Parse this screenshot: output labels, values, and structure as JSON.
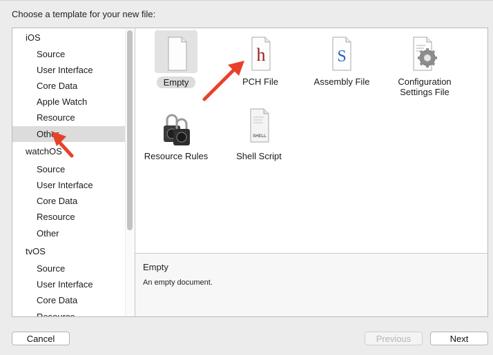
{
  "heading": "Choose a template for your new file:",
  "sidebar": {
    "items": [
      {
        "label": "iOS",
        "kind": "group"
      },
      {
        "label": "Source",
        "kind": "sub"
      },
      {
        "label": "User Interface",
        "kind": "sub"
      },
      {
        "label": "Core Data",
        "kind": "sub"
      },
      {
        "label": "Apple Watch",
        "kind": "sub"
      },
      {
        "label": "Resource",
        "kind": "sub"
      },
      {
        "label": "Other",
        "kind": "sub",
        "selected": true
      },
      {
        "label": "watchOS",
        "kind": "group"
      },
      {
        "label": "Source",
        "kind": "sub"
      },
      {
        "label": "User Interface",
        "kind": "sub"
      },
      {
        "label": "Core Data",
        "kind": "sub"
      },
      {
        "label": "Resource",
        "kind": "sub"
      },
      {
        "label": "Other",
        "kind": "sub"
      },
      {
        "label": "tvOS",
        "kind": "group"
      },
      {
        "label": "Source",
        "kind": "sub"
      },
      {
        "label": "User Interface",
        "kind": "sub"
      },
      {
        "label": "Core Data",
        "kind": "sub"
      },
      {
        "label": "Resource",
        "kind": "sub"
      }
    ]
  },
  "templates": [
    {
      "label": "Empty",
      "icon": "blank-document-icon",
      "selected": true
    },
    {
      "label": "PCH File",
      "icon": "header-file-icon",
      "glyph": "h"
    },
    {
      "label": "Assembly File",
      "icon": "assembly-file-icon",
      "glyph": "S"
    },
    {
      "label": "Configuration",
      "label2": "Settings File",
      "icon": "config-settings-icon"
    },
    {
      "label": "Resource Rules",
      "icon": "padlocks-icon"
    },
    {
      "label": "Shell Script",
      "icon": "shell-script-icon",
      "glyph": "SHELL"
    }
  ],
  "description": {
    "title": "Empty",
    "text": "An empty document."
  },
  "buttons": {
    "cancel": "Cancel",
    "previous": "Previous",
    "next": "Next"
  },
  "colors": {
    "annotation_arrow": "#e8412a",
    "selection": "#dcdcdc",
    "pch_glyph": "#9b1b1b",
    "assembly_glyph": "#2a62c9"
  }
}
